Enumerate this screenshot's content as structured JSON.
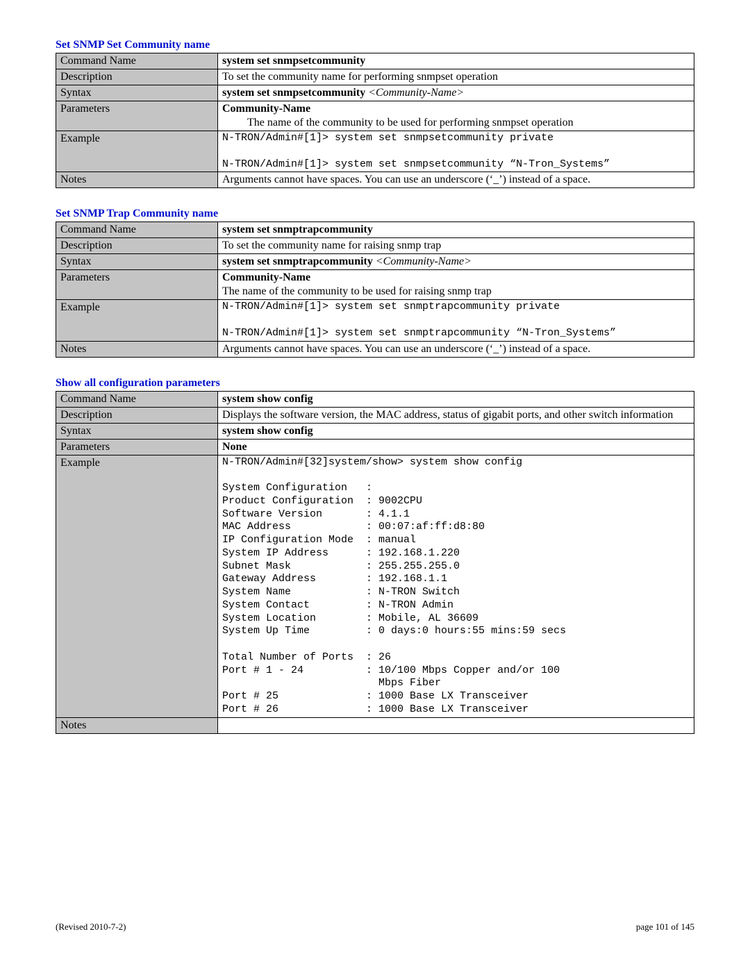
{
  "sections": [
    {
      "title": "Set SNMP Set Community name",
      "rows": {
        "commandName": "system set snmpsetcommunity",
        "description": "To set the community name for performing snmpset operation",
        "syntaxBold": "system set snmpsetcommunity  ",
        "syntaxItal": "<Community-Name>",
        "paramsHead": "Community-Name",
        "paramsBody": "The name of the community to be used for performing snmpset operation",
        "example": "N-TRON/Admin#[1]> system set snmpsetcommunity private\n\nN-TRON/Admin#[1]> system set snmpsetcommunity “N-Tron_Systems”",
        "notes": "Arguments cannot have spaces.  You can use an underscore (‘_’) instead of a space."
      }
    },
    {
      "title": "Set SNMP Trap Community name",
      "rows": {
        "commandName": "system set snmptrapcommunity",
        "description": "To set the community name for raising snmp trap",
        "syntaxBold": "system set snmptrapcommunity  ",
        "syntaxItal": "<Community-Name>",
        "paramsHead": "Community-Name",
        "paramsBody": "The name of the community to be used for raising snmp trap",
        "example": "N-TRON/Admin#[1]> system set snmptrapcommunity private\n\nN-TRON/Admin#[1]> system set snmptrapcommunity “N-Tron_Systems”",
        "notes": "Arguments cannot have spaces.  You can use an underscore (‘_’) instead of a space."
      }
    },
    {
      "title": "Show all configuration parameters",
      "rows": {
        "commandName": "system show config",
        "description": "Displays the software version, the MAC address, status of gigabit ports, and other switch information",
        "syntaxBold": "system show config",
        "syntaxItal": "",
        "paramsHead": "None",
        "paramsBody": "",
        "example": "N-TRON/Admin#[32]system/show> system show config\n\nSystem Configuration   :\nProduct Configuration  : 9002CPU\nSoftware Version       : 4.1.1\nMAC Address            : 00:07:af:ff:d8:80\nIP Configuration Mode  : manual\nSystem IP Address      : 192.168.1.220\nSubnet Mask            : 255.255.255.0\nGateway Address        : 192.168.1.1\nSystem Name            : N-TRON Switch\nSystem Contact         : N-TRON Admin\nSystem Location        : Mobile, AL 36609\nSystem Up Time         : 0 days:0 hours:55 mins:59 secs\n\nTotal Number of Ports  : 26\nPort # 1 - 24          : 10/100 Mbps Copper and/or 100\n                         Mbps Fiber\nPort # 25              : 1000 Base LX Transceiver\nPort # 26              : 1000 Base LX Transceiver",
        "notes": ""
      }
    }
  ],
  "rowLabels": {
    "commandName": "Command Name",
    "description": "Description",
    "syntax": "Syntax",
    "parameters": "Parameters",
    "example": "Example",
    "notes": "Notes"
  },
  "footer": {
    "left": "(Revised 2010-7-2)",
    "right": "page 101 of 145"
  },
  "chart_data": {
    "type": "table",
    "tables": [
      {
        "title": "Set SNMP Set Community name",
        "rows": [
          [
            "Command Name",
            "system set snmpsetcommunity"
          ],
          [
            "Description",
            "To set the community name for performing snmpset operation"
          ],
          [
            "Syntax",
            "system set snmpsetcommunity  <Community-Name>"
          ],
          [
            "Parameters",
            "Community-Name — The name of the community to be used for performing snmpset operation"
          ],
          [
            "Example",
            "N-TRON/Admin#[1]> system set snmpsetcommunity private; N-TRON/Admin#[1]> system set snmpsetcommunity \"N-Tron_Systems\""
          ],
          [
            "Notes",
            "Arguments cannot have spaces. You can use an underscore ('_') instead of a space."
          ]
        ]
      },
      {
        "title": "Set SNMP Trap Community name",
        "rows": [
          [
            "Command Name",
            "system set snmptrapcommunity"
          ],
          [
            "Description",
            "To set the community name for raising snmp trap"
          ],
          [
            "Syntax",
            "system set snmptrapcommunity  <Community-Name>"
          ],
          [
            "Parameters",
            "Community-Name — The name of the community to be used for raising snmp trap"
          ],
          [
            "Example",
            "N-TRON/Admin#[1]> system set snmptrapcommunity private; N-TRON/Admin#[1]> system set snmptrapcommunity \"N-Tron_Systems\""
          ],
          [
            "Notes",
            "Arguments cannot have spaces. You can use an underscore ('_') instead of a space."
          ]
        ]
      },
      {
        "title": "Show all configuration parameters",
        "rows": [
          [
            "Command Name",
            "system show config"
          ],
          [
            "Description",
            "Displays the software version, the MAC address, status of gigabit ports, and other switch information"
          ],
          [
            "Syntax",
            "system show config"
          ],
          [
            "Parameters",
            "None"
          ],
          [
            "Example",
            "System Configuration output (product 9002CPU, sw 4.1.1, MAC 00:07:af:ff:d8:80, IP 192.168.1.220, 26 ports, etc.)"
          ],
          [
            "Notes",
            ""
          ]
        ]
      }
    ]
  }
}
